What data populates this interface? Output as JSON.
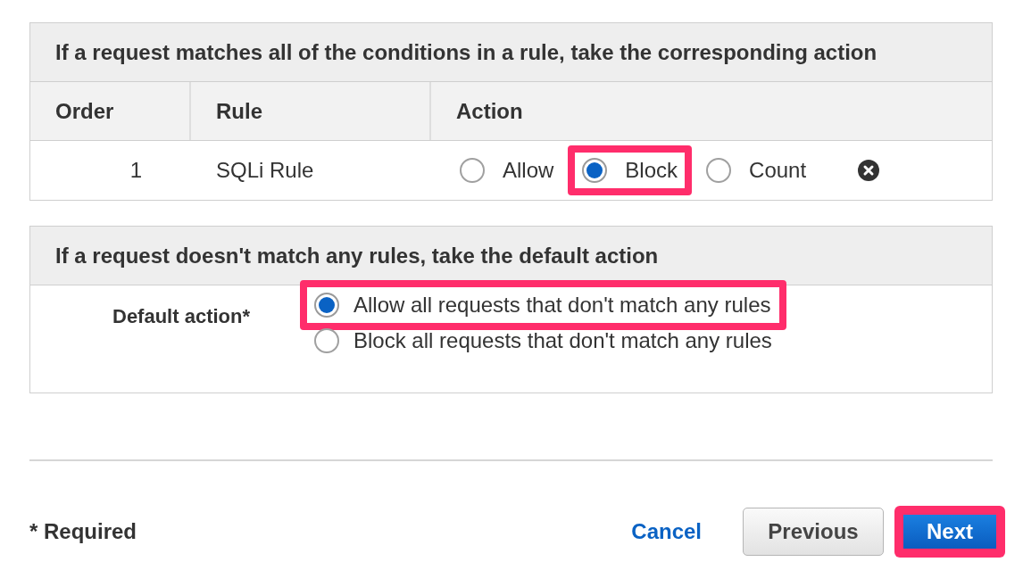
{
  "rules_panel": {
    "title": "If a request matches all of the conditions in a rule, take the corresponding action",
    "columns": [
      "Order",
      "Rule",
      "Action"
    ],
    "rows": [
      {
        "order": "1",
        "rule": "SQLi Rule",
        "actions": [
          {
            "label": "Allow",
            "selected": false,
            "highlighted": false
          },
          {
            "label": "Block",
            "selected": true,
            "highlighted": true
          },
          {
            "label": "Count",
            "selected": false,
            "highlighted": false
          }
        ]
      }
    ]
  },
  "default_panel": {
    "title": "If a request doesn't match any rules, take the default action",
    "label": "Default action*",
    "options": [
      {
        "label": "Allow all requests that don't match any rules",
        "selected": true,
        "highlighted": true
      },
      {
        "label": "Block all requests that don't match any rules",
        "selected": false,
        "highlighted": false
      }
    ]
  },
  "footer": {
    "required_note": "* Required",
    "cancel": "Cancel",
    "previous": "Previous",
    "next": {
      "label": "Next",
      "highlighted": true
    }
  }
}
